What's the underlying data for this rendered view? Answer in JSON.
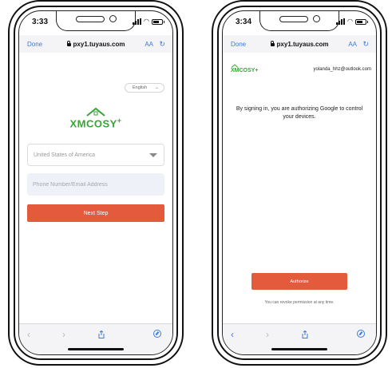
{
  "left_screen": {
    "status_time": "3:33",
    "browser": {
      "done_label": "Done",
      "url": "pxy1.tuyaus.com",
      "text_size_label": "AA"
    },
    "language_select": {
      "value": "English"
    },
    "logo": {
      "text": "XMCOSY",
      "plus": "+"
    },
    "country_select": {
      "value": "United States of America"
    },
    "account_input": {
      "placeholder": "Phone Number/Email Address"
    },
    "next_button": {
      "label": "Next Step"
    }
  },
  "right_screen": {
    "status_time": "3:34",
    "browser": {
      "done_label": "Done",
      "url": "pxy1.tuyaus.com",
      "text_size_label": "AA"
    },
    "logo": {
      "text": "XMCOSY",
      "plus": "+"
    },
    "account_email": "yolanda_hhz@outlook.com",
    "auth_message": "By signing in, you are authorizing Google to control your devices.",
    "authorize_button": {
      "label": "Authorize"
    },
    "revoke_note": "You can revoke permission at any time."
  },
  "colors": {
    "accent": "#e35a3c",
    "brand_green": "#3aa33a",
    "link_blue": "#3a7bdc"
  },
  "icons": [
    "lock-icon",
    "reload-icon",
    "back-icon",
    "forward-icon",
    "share-icon",
    "compass-icon",
    "chevron-down-icon",
    "dropdown-triangle-icon"
  ]
}
